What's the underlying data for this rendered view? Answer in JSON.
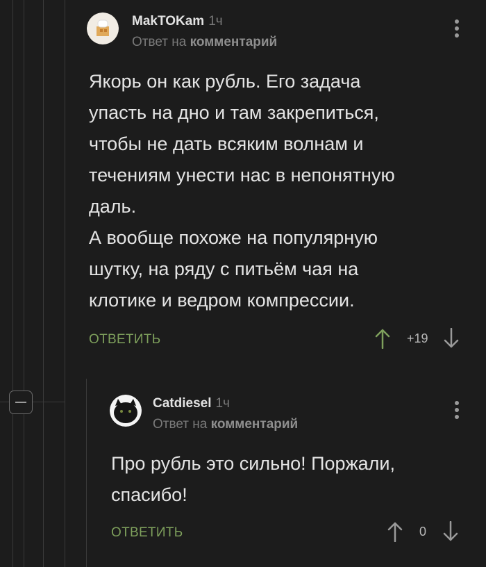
{
  "comment1": {
    "author": "MakTOKam",
    "time": "1ч",
    "reply_prefix": "Ответ на",
    "reply_target": "комментарий",
    "text": "Якорь он как рубль. Его задача\nупасть на дно и там закрепиться,\nчтобы не дать всяким волнам и\nтечениям унести нас в непонятную\nдаль.\nА вообще похоже на популярную\nшутку, на ряду с питьём чая на\nклотике и ведром компрессии.",
    "reply_label": "ОТВЕТИТЬ",
    "score": "+19"
  },
  "comment2": {
    "author": "Catdiesel",
    "time": "1ч",
    "reply_prefix": "Ответ на",
    "reply_target": "комментарий",
    "text": "Про рубль это сильно! Поржали,\nспасибо!",
    "reply_label": "ОТВЕТИТЬ",
    "score": "0"
  },
  "colors": {
    "background": "#1c1c1c",
    "upvote_active": "#7ea05c",
    "reply_link": "#7ea05c",
    "muted": "#7a7a7a"
  },
  "icons": [
    "kebab-menu-icon",
    "upvote-arrow-icon",
    "downvote-arrow-icon",
    "collapse-minus-icon"
  ]
}
